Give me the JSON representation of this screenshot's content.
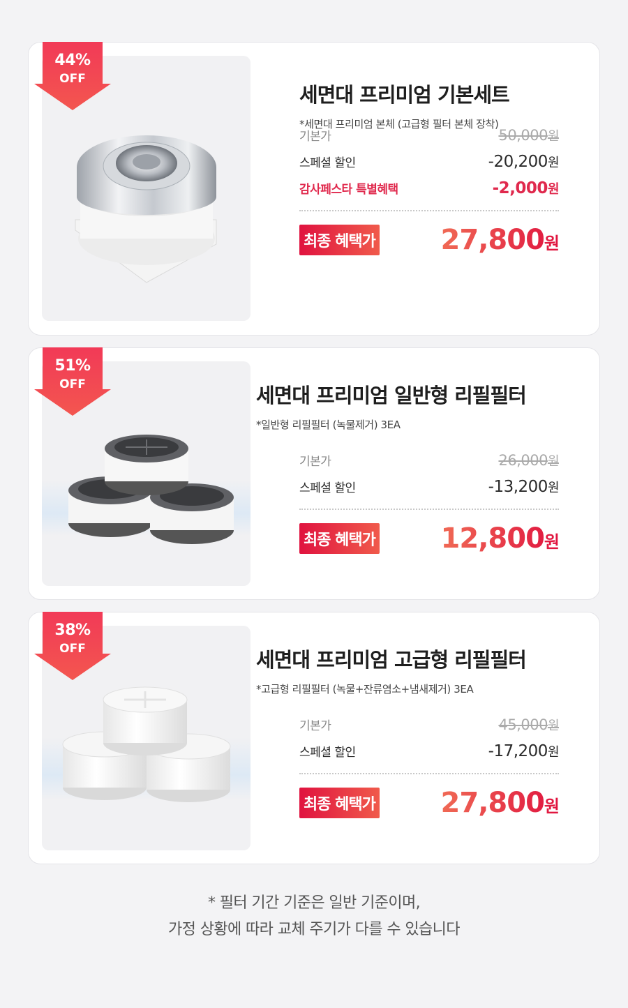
{
  "products": [
    {
      "discount": {
        "percent": "44%",
        "off": "OFF"
      },
      "title": "세면대 프리미엄 기본세트",
      "subtitle": "*세면대 프리미엄 본체 (고급형 필터 본체 장착)",
      "image": "chrome-faucet-filter",
      "base_label": "기본가",
      "base_price": "50,000",
      "special_label": "스페셜 할인",
      "special_price": "-20,200",
      "event_label": "감사페스타 특별혜택",
      "event_price": "-2,000",
      "final_label": "최종 혜택가",
      "final_price": "27,800",
      "won": "원"
    },
    {
      "discount": {
        "percent": "51%",
        "off": "OFF"
      },
      "title": "세면대 프리미엄 일반형 리필필터",
      "subtitle": "*일반형 리필필터 (녹물제거) 3EA",
      "image": "standard-refill-filters-3ea",
      "base_label": "기본가",
      "base_price": "26,000",
      "special_label": "스페셜 할인",
      "special_price": "-13,200",
      "final_label": "최종 혜택가",
      "final_price": "12,800",
      "won": "원"
    },
    {
      "discount": {
        "percent": "38%",
        "off": "OFF"
      },
      "title": "세면대 프리미엄 고급형 리필필터",
      "subtitle": "*고급형 리필필터 (녹물+잔류염소+냄새제거) 3EA",
      "image": "premium-refill-filters-3ea",
      "base_label": "기본가",
      "base_price": "45,000",
      "special_label": "스페셜 할인",
      "special_price": "-17,200",
      "final_label": "최종 혜택가",
      "final_price": "27,800",
      "won": "원"
    }
  ],
  "footnote": {
    "line1": "* 필터 기간 기준은 일반 기준이며,",
    "line2": "가정 상황에 따라 교체 주기가 다를 수 있습니다"
  },
  "colors": {
    "accent": "#e0133f",
    "accent_light": "#f05a4b",
    "badge": "#f0405a",
    "card_bg": "#ffffff",
    "page_bg": "#f3f3f5"
  }
}
